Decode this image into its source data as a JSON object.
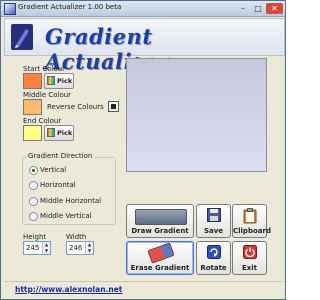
{
  "window": {
    "title": "Gradient Actualizer 1.00 beta",
    "controls": {
      "minimize": "–",
      "maximize": "□",
      "close": "✕"
    }
  },
  "banner": {
    "title": "Gradient Actualizer",
    "logo_icon": "pen-logo-icon"
  },
  "colours": {
    "start_label": "Start Colour",
    "start_value": "#ff7f3c",
    "middle_label": "Middle Colour",
    "middle_value": "#ffb870",
    "reverse_label": "Reverse Colours",
    "reverse_checked": true,
    "end_label": "End Colour",
    "end_value": "#ffff88",
    "pick_label": "Pick"
  },
  "direction": {
    "title": "Gradient Direction",
    "options": [
      {
        "label": "Vertical",
        "selected": true
      },
      {
        "label": "Horizontal",
        "selected": false
      },
      {
        "label": "Middle Horizontal",
        "selected": false
      },
      {
        "label": "Middle Vertical",
        "selected": false
      }
    ]
  },
  "size": {
    "height_label": "Height",
    "height_value": "245",
    "width_label": "Width",
    "width_value": "246"
  },
  "preview": {
    "top_color": "#c5c8dc",
    "bottom_color": "#dcdff0"
  },
  "buttons": {
    "draw": "Draw Gradient",
    "save": "Save",
    "clipboard": "Clipboard",
    "erase": "Erase Gradient",
    "rotate": "Rotate",
    "exit": "Exit"
  },
  "footer": {
    "link": "http://www.alexnolan.net"
  }
}
